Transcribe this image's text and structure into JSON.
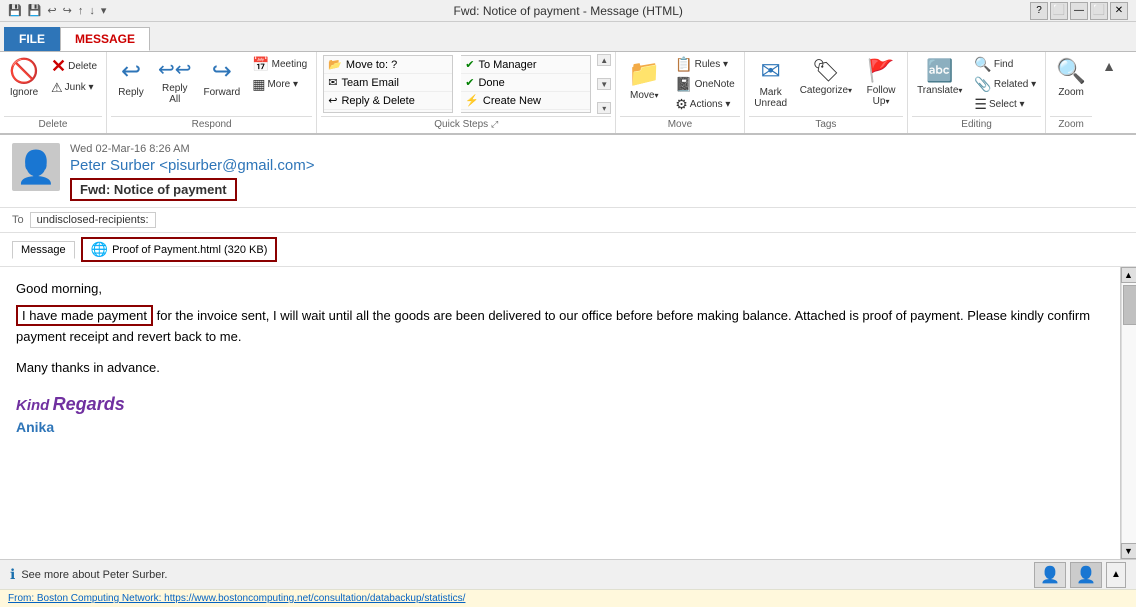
{
  "titlebar": {
    "title": "Fwd: Notice of payment - Message (HTML)",
    "controls": [
      "?",
      "⬜",
      "—",
      "⬜",
      "✕"
    ]
  },
  "ribbon_tabs": [
    {
      "id": "file",
      "label": "FILE",
      "active": false,
      "style": "file"
    },
    {
      "id": "message",
      "label": "MESSAGE",
      "active": true,
      "style": "normal"
    }
  ],
  "groups": {
    "delete": {
      "label": "Delete",
      "ignore_btn": {
        "icon": "🚫",
        "label": "Ignore"
      },
      "junk_btn": {
        "icon": "⚠",
        "label": "Junk ▾"
      },
      "delete_btn": {
        "icon": "✕",
        "label": "Delete"
      }
    },
    "respond": {
      "label": "Respond",
      "reply_btn": {
        "icon": "↩",
        "label": "Reply"
      },
      "reply_all_btn": {
        "icon": "↩↩",
        "label": "Reply\nAll"
      },
      "forward_btn": {
        "icon": "↪",
        "label": "Forward"
      },
      "meeting_btn": {
        "icon": "📅",
        "label": "Meeting"
      },
      "more_btn": {
        "icon": "▦",
        "label": "More ▾"
      }
    },
    "quicksteps": {
      "label": "Quick Steps",
      "items": [
        {
          "icon": "→",
          "label": "Move to: ?"
        },
        {
          "icon": "✉",
          "label": "Team Email"
        },
        {
          "icon": "↩",
          "label": "Reply & Delete"
        }
      ],
      "right_items": [
        {
          "icon": "✔",
          "label": "To Manager"
        },
        {
          "icon": "✔",
          "label": "Done"
        },
        {
          "icon": "⚡",
          "label": "Create New"
        }
      ]
    },
    "move": {
      "label": "Move",
      "move_btn": {
        "icon": "📂",
        "label": "Move"
      },
      "rules_btn": {
        "icon": "📋",
        "label": "Rules ▾"
      },
      "onenote_btn": {
        "icon": "📓",
        "label": "OneNote"
      },
      "actions_btn": {
        "icon": "⚙",
        "label": "Actions ▾"
      }
    },
    "tags": {
      "label": "Tags",
      "mark_unread_btn": {
        "icon": "✉",
        "label": "Mark\nUnread"
      },
      "categorize_btn": {
        "icon": "🏷",
        "label": "Categorize ▾"
      },
      "follow_up_btn": {
        "icon": "🚩",
        "label": "Follow\nUp ▾"
      }
    },
    "editing": {
      "label": "Editing",
      "translate_btn": {
        "icon": "🌐",
        "label": "Translate ▾"
      },
      "find_btn": {
        "icon": "🔍",
        "label": "Find"
      },
      "related_btn": {
        "icon": "📎",
        "label": "Related ▾"
      },
      "select_btn": {
        "icon": "☰",
        "label": "Select ▾"
      }
    },
    "zoom": {
      "label": "Zoom",
      "zoom_btn": {
        "icon": "🔍",
        "label": "Zoom"
      }
    }
  },
  "email": {
    "date": "Wed 02-Mar-16 8:26 AM",
    "from": "Peter Surber <pisurber@gmail.com>",
    "subject": "Fwd: Notice of payment",
    "to_label": "To",
    "to_value": "undisclosed-recipients:",
    "attachment_tab": "Message",
    "attachment_file": "Proof of Payment.html (320 KB)",
    "body_greeting": "Good morning,",
    "body_highlight": "I have made payment",
    "body_text": " for the invoice sent, I will wait until all the goods are been delivered to our office before before making balance.  Attached is proof of payment. Please kindly confirm payment receipt and revert back to me.",
    "body_line2": "Many thanks in advance.",
    "sig_kind": "Kind",
    "sig_regards": "Regards",
    "sig_name": "Anika"
  },
  "statusbar": {
    "info_text": "See more about Peter Surber."
  },
  "bottombar": {
    "link": "From: Boston Computing Network: https://www.bostoncomputing.net/consultation/databackup/statistics/"
  }
}
